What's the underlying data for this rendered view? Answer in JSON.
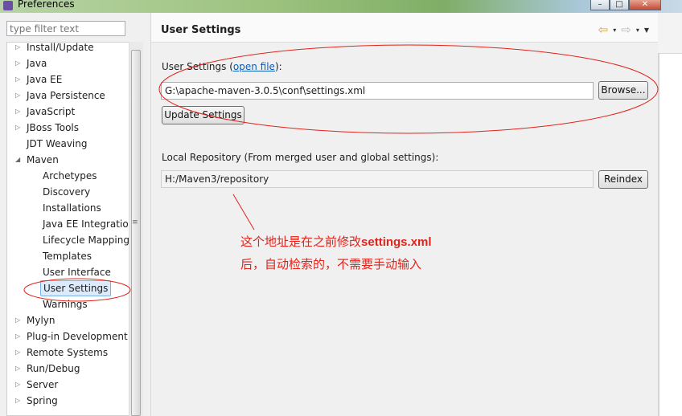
{
  "window": {
    "title": "Preferences",
    "minimize": "–",
    "maximize": "□",
    "close": "✕"
  },
  "filter": {
    "placeholder": "type filter text"
  },
  "tree": {
    "items": [
      {
        "label": "Install/Update"
      },
      {
        "label": "Java"
      },
      {
        "label": "Java EE"
      },
      {
        "label": "Java Persistence"
      },
      {
        "label": "JavaScript"
      },
      {
        "label": "JBoss Tools"
      },
      {
        "label": "JDT Weaving"
      },
      {
        "label": "Maven"
      },
      {
        "label": "Archetypes"
      },
      {
        "label": "Discovery"
      },
      {
        "label": "Installations"
      },
      {
        "label": "Java EE Integration"
      },
      {
        "label": "Lifecycle Mapping"
      },
      {
        "label": "Templates"
      },
      {
        "label": "User Interface"
      },
      {
        "label": "User Settings"
      },
      {
        "label": "Warnings"
      },
      {
        "label": "Mylyn"
      },
      {
        "label": "Plug-in Development"
      },
      {
        "label": "Remote Systems"
      },
      {
        "label": "Run/Debug"
      },
      {
        "label": "Server"
      },
      {
        "label": "Spring"
      }
    ],
    "scroll_grip": "≡"
  },
  "page": {
    "title": "User Settings"
  },
  "nav": {
    "back": "⇦",
    "forward": "⇨",
    "dropdown": "▾",
    "menu": "▼"
  },
  "user_settings": {
    "label_prefix": "User Settings (",
    "link": "open file",
    "label_suffix": "):",
    "path": "G:\\apache-maven-3.0.5\\conf\\settings.xml",
    "browse": "Browse...",
    "update": "Update Settings"
  },
  "local_repo": {
    "label": "Local Repository (From merged user and global settings):",
    "path": "H:/Maven3/repository",
    "reindex": "Reindex"
  },
  "annotation": {
    "line1_a": "这个地址是在之前修改",
    "line1_b": "settings.xml",
    "line2": "后，自动检索的，不需要手动输入",
    "color": "#e2231a"
  },
  "colors": {
    "selection": "#dcebfb",
    "link": "#0b5db8"
  }
}
